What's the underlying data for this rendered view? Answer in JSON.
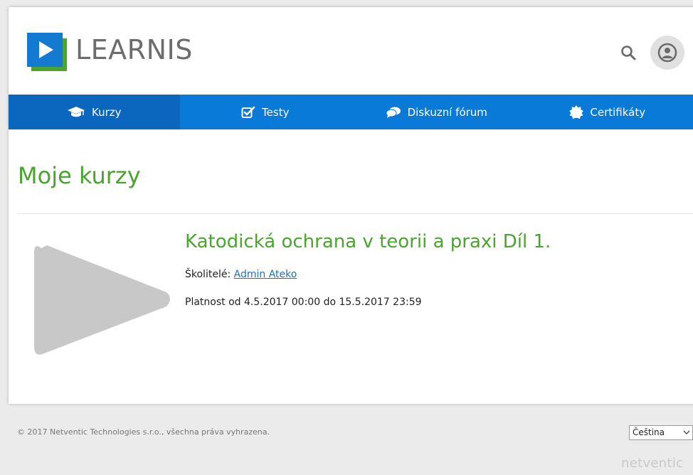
{
  "brand": {
    "logo_text": "LEARNIS",
    "primary_color": "#0a7ad8",
    "active_tab_color": "#0b67be",
    "accent_green": "#4aa52e"
  },
  "header": {
    "search_icon": "search-icon",
    "avatar_icon": "user-icon"
  },
  "nav": {
    "items": [
      {
        "label": "Kurzy",
        "icon": "graduation-cap-icon",
        "active": true
      },
      {
        "label": "Testy",
        "icon": "checkbox-icon",
        "active": false
      },
      {
        "label": "Diskuzní fórum",
        "icon": "comments-icon",
        "active": false
      },
      {
        "label": "Certifikáty",
        "icon": "certificate-icon",
        "active": false
      }
    ]
  },
  "main": {
    "title": "Moje kurzy",
    "courses": [
      {
        "title": "Katodická ochrana v teorii a praxi Díl 1.",
        "trainers_label": "Školitelé:",
        "trainer_name": "Admin Ateko",
        "validity": "Platnost od 4.5.2017 00:00 do 15.5.2017 23:59",
        "thumbnail_icon": "play-icon"
      }
    ]
  },
  "footer": {
    "copyright": "© 2017 Netventic Technologies s.r.o., všechna práva vyhrazena.",
    "language_selected": "Čeština",
    "brand_text": "netventic"
  }
}
